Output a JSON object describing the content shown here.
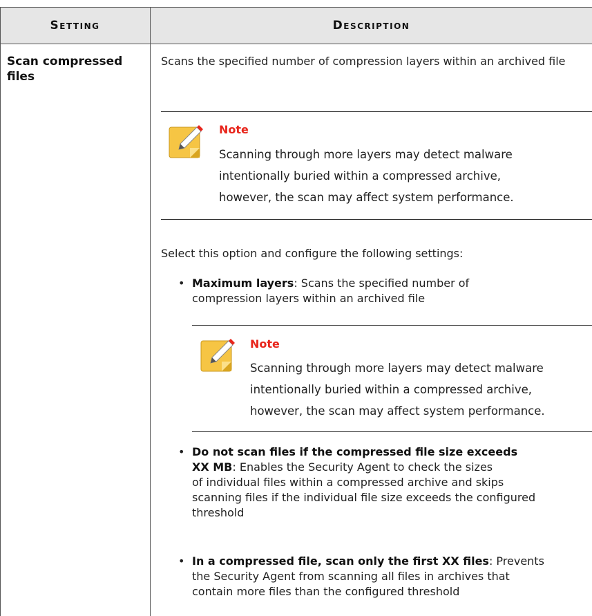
{
  "header": {
    "setting": "Setting",
    "description": "Description"
  },
  "row": {
    "setting_name": "Scan compressed files",
    "intro": "Scans the specified number of compression layers within an archived file",
    "note1": {
      "title": "Note",
      "lines": [
        "Scanning through more layers may detect malware",
        "intentionally buried within a compressed archive,",
        "however, the scan may affect system performance."
      ]
    },
    "select_text": "Select this option and configure the following settings:",
    "bullets": [
      {
        "bold": "Maximum layers",
        "line1": ": Scans the specified number of",
        "line2": "compression layers within an archived file"
      },
      {
        "bold_line1": "Do not scan files if the compressed file size exceeds",
        "bold_line2": "XX MB",
        "line2": ": Enables the Security Agent to check the sizes",
        "line3": "of individual files within a compressed archive and skips",
        "line4": "scanning files if the individual file size exceeds the configured",
        "line5": "threshold"
      },
      {
        "bold": "In a compressed file, scan only the first XX files",
        "line1": ": Prevents",
        "line2": "the Security Agent from scanning all files in archives that",
        "line3": "contain more files than the configured threshold"
      }
    ],
    "note2": {
      "title": "Note",
      "lines": [
        "Scanning through more layers may detect malware",
        "intentionally buried within a compressed archive,",
        "however, the scan may affect system performance."
      ]
    }
  },
  "colors": {
    "note_title": "#e8261c",
    "header_bg": "#e6e6e6",
    "icon_fill": "#f6c544"
  }
}
